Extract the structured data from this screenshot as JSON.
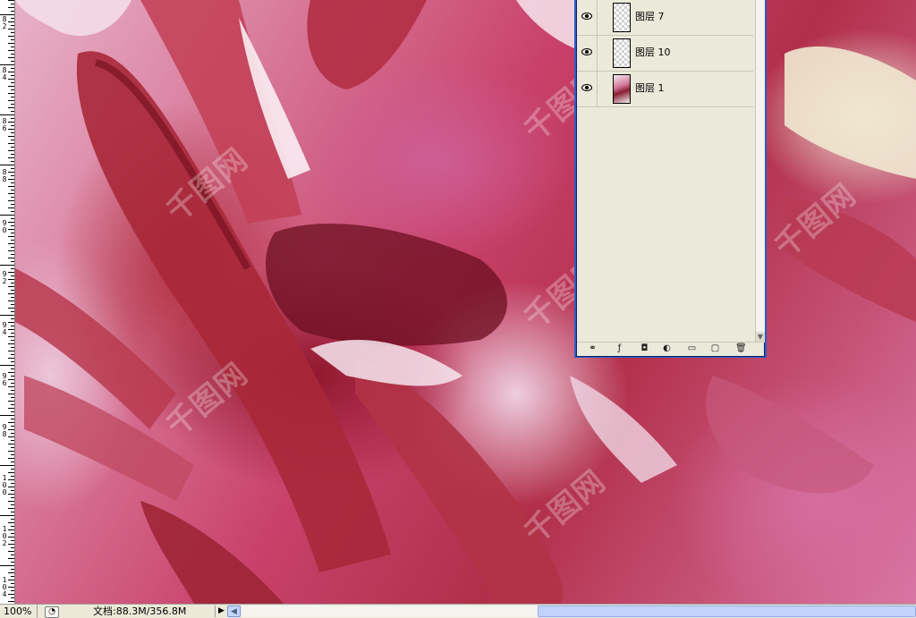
{
  "ruler": {
    "labels": [
      "8\n2",
      "8\n4",
      "8\n6",
      "8\n8",
      "9\n0",
      "9\n2",
      "9\n4",
      "9\n6",
      "9\n8",
      "1\n0\n0",
      "1\n0\n2",
      "1\n0\n4"
    ]
  },
  "watermark": {
    "text": "千图网"
  },
  "layers": {
    "items": [
      {
        "name": "图层 7",
        "visible": true,
        "selected": true,
        "thumbnail": "transparent"
      },
      {
        "name": "图层 10",
        "visible": true,
        "selected": false,
        "thumbnail": "transparent"
      },
      {
        "name": "图层 1",
        "visible": true,
        "selected": false,
        "thumbnail": "image"
      }
    ],
    "toolbar_icons": [
      "link-icon",
      "layer-style-icon",
      "layer-mask-icon",
      "adjustment-layer-icon",
      "group-folder-icon",
      "new-layer-icon",
      "trash-icon"
    ],
    "toolbar_glyphs": [
      "⚭",
      "ƒ",
      "◘",
      "◐",
      "▭",
      "▢",
      "🗑"
    ]
  },
  "status": {
    "zoom": "100%",
    "doc_info": "文档:88.3M/356.8M",
    "menu_arrow": "▶",
    "scroll_left": "◀"
  },
  "colors": {
    "selection": "#316ac5",
    "panel_bg": "#ebe9d9",
    "panel_frame": "#2d5cc3",
    "status_bg": "#ece9d8"
  }
}
